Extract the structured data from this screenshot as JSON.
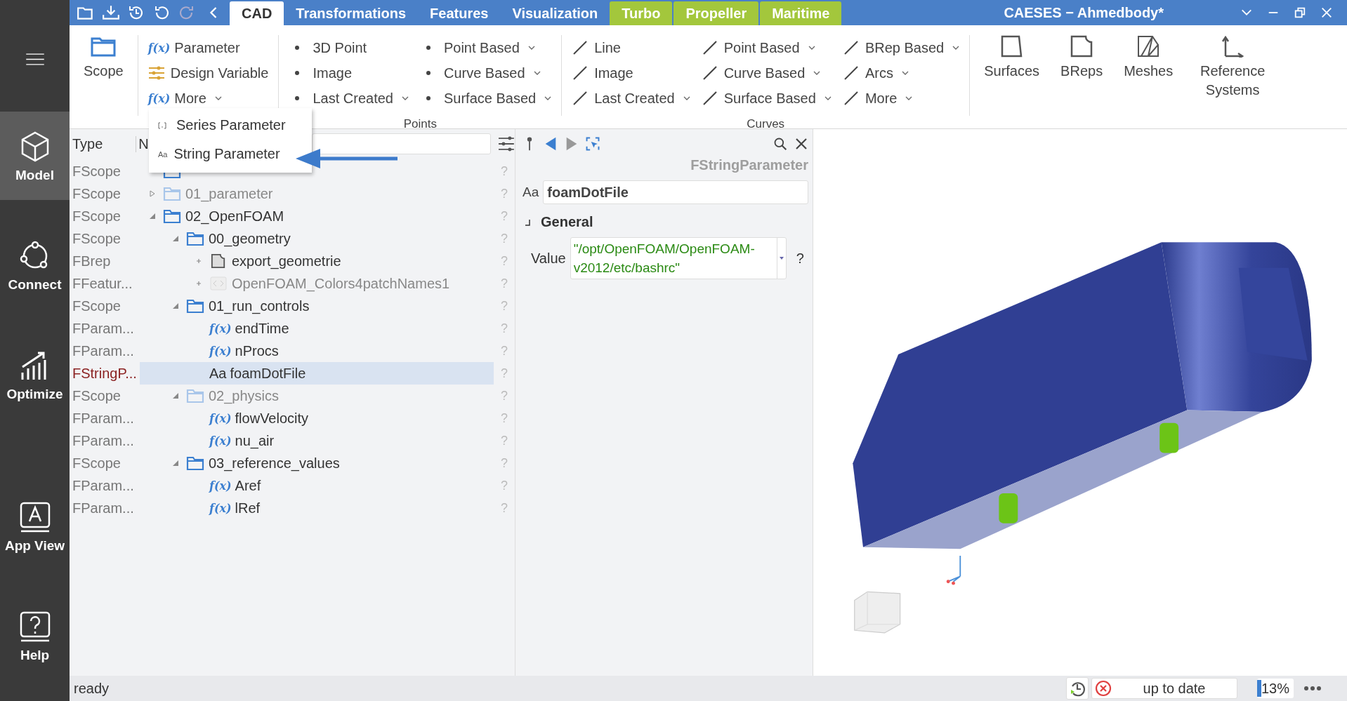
{
  "sidebar": {
    "items": [
      {
        "label": "Model",
        "kind": "cube",
        "selected": true
      },
      {
        "label": "Connect",
        "kind": "connect",
        "selected": false
      },
      {
        "label": "Optimize",
        "kind": "chart",
        "selected": false
      },
      {
        "label": "App View",
        "kind": "app",
        "selected": false
      },
      {
        "label": "Help",
        "kind": "help",
        "selected": false
      }
    ]
  },
  "tabs": [
    {
      "label": "CAD",
      "selected": true,
      "kind": "plain"
    },
    {
      "label": "Transformations",
      "selected": false,
      "kind": "plain"
    },
    {
      "label": "Features",
      "selected": false,
      "kind": "plain"
    },
    {
      "label": "Visualization",
      "selected": false,
      "kind": "plain"
    },
    {
      "label": "Turbo",
      "selected": false,
      "kind": "addon"
    },
    {
      "label": "Propeller",
      "selected": false,
      "kind": "addon"
    },
    {
      "label": "Maritime",
      "selected": false,
      "kind": "addon"
    }
  ],
  "window": {
    "title": "CAESES − Ahmedbody*"
  },
  "ribbon": {
    "groups": [
      {
        "kind": "big",
        "buttons": [
          {
            "label": "Scope",
            "kind": "folder"
          }
        ]
      },
      {
        "kind": "list",
        "columns": [
          [
            {
              "label": "Parameter",
              "kind": "fx",
              "icon_text": "f(x)",
              "dropdown": false
            },
            {
              "label": "Design Variable",
              "kind": "sliders",
              "dropdown": false
            },
            {
              "label": "More",
              "kind": "fx",
              "icon_text": "f(x)",
              "dropdown": true
            }
          ]
        ]
      },
      {
        "kind": "list",
        "title": "Points",
        "columns": [
          [
            {
              "label": "3D Point",
              "kind": "bullet",
              "dropdown": false
            },
            {
              "label": "Image",
              "kind": "bullet",
              "dropdown": false
            },
            {
              "label": "Last Created",
              "kind": "bullet",
              "dropdown": true
            }
          ],
          [
            {
              "label": "Point Based",
              "kind": "bullet",
              "dropdown": true
            },
            {
              "label": "Curve Based",
              "kind": "bullet",
              "dropdown": true
            },
            {
              "label": "Surface Based",
              "kind": "bullet",
              "dropdown": true
            }
          ]
        ]
      },
      {
        "kind": "list",
        "title": "Curves",
        "columns": [
          [
            {
              "label": "Line",
              "kind": "line",
              "dropdown": false
            },
            {
              "label": "Image",
              "kind": "line",
              "dropdown": false
            },
            {
              "label": "Last Created",
              "kind": "line",
              "dropdown": true
            }
          ],
          [
            {
              "label": "Point Based",
              "kind": "line",
              "dropdown": true
            },
            {
              "label": "Curve Based",
              "kind": "line",
              "dropdown": true
            },
            {
              "label": "Surface Based",
              "kind": "line",
              "dropdown": true
            }
          ],
          [
            {
              "label": "BRep Based",
              "kind": "line",
              "dropdown": true
            },
            {
              "label": "Arcs",
              "kind": "line",
              "dropdown": true
            },
            {
              "label": "More",
              "kind": "line",
              "dropdown": true
            }
          ]
        ]
      },
      {
        "kind": "big",
        "buttons": [
          {
            "label": "Surfaces",
            "kind": "surface"
          },
          {
            "label": "BReps",
            "kind": "brep"
          },
          {
            "label": "Meshes",
            "kind": "mesh"
          },
          {
            "label": "Reference Systems",
            "kind": "axes"
          }
        ]
      }
    ]
  },
  "dropdown_menu": {
    "items": [
      {
        "label": "Series Parameter",
        "kind": "series"
      },
      {
        "label": "String Parameter",
        "kind": "string",
        "icon_text": "Aa"
      }
    ]
  },
  "tree": {
    "columns": [
      "Type",
      "N"
    ],
    "items": [
      {
        "type": "FScope",
        "kind": "folder",
        "selected": false,
        "dimmed": false
      },
      {
        "type": "FScope",
        "name": "01_parameter",
        "kind": "folder",
        "expanded": false,
        "selected": false,
        "dimmed": true
      },
      {
        "type": "FScope",
        "name": "02_OpenFOAM",
        "kind": "folder",
        "expanded": true,
        "selected": false,
        "dimmed": false,
        "children": [
          {
            "type": "FScope",
            "name": "00_geometry",
            "kind": "folder",
            "expanded": true,
            "selected": false,
            "dimmed": false,
            "children": [
              {
                "type": "FBrep",
                "name": "export_geometrie",
                "kind": "brep",
                "expanded": false,
                "selected": false,
                "dimmed": false
              },
              {
                "type": "FFeatur...",
                "name": "OpenFOAM_Colors4patchNames1",
                "kind": "feature",
                "expanded": false,
                "selected": false,
                "dimmed": true
              }
            ]
          },
          {
            "type": "FScope",
            "name": "01_run_controls",
            "kind": "folder",
            "expanded": true,
            "selected": false,
            "dimmed": false,
            "children": [
              {
                "type": "FParam...",
                "name": "endTime",
                "kind": "parameter",
                "icon_text": "f(x)",
                "selected": false,
                "dimmed": false
              },
              {
                "type": "FParam...",
                "name": "nProcs",
                "kind": "parameter",
                "icon_text": "f(x)",
                "selected": false,
                "dimmed": false
              },
              {
                "type": "FStringP...",
                "name": "foamDotFile",
                "kind": "string",
                "icon_text": "Aa",
                "selected": true,
                "dimmed": false
              }
            ]
          },
          {
            "type": "FScope",
            "name": "02_physics",
            "kind": "folder",
            "expanded": true,
            "selected": false,
            "dimmed": true,
            "children": [
              {
                "type": "FParam...",
                "name": "flowVelocity",
                "kind": "parameter",
                "icon_text": "f(x)",
                "selected": false,
                "dimmed": false
              },
              {
                "type": "FParam...",
                "name": "nu_air",
                "kind": "parameter",
                "icon_text": "f(x)",
                "selected": false,
                "dimmed": false
              }
            ]
          },
          {
            "type": "FScope",
            "name": "03_reference_values",
            "kind": "folder",
            "expanded": true,
            "selected": false,
            "dimmed": false,
            "children": [
              {
                "type": "FParam...",
                "name": "Aref",
                "kind": "parameter",
                "icon_text": "f(x)",
                "selected": false,
                "dimmed": false
              },
              {
                "type": "FParam...",
                "name": "lRef",
                "kind": "parameter",
                "icon_text": "f(x)",
                "selected": false,
                "dimmed": false
              }
            ]
          }
        ]
      }
    ],
    "help_mark": "?"
  },
  "properties": {
    "type_title": "FStringParameter",
    "name_prefix": "Aa",
    "name": "foamDotFile",
    "section": {
      "title": "General",
      "expanded": true
    },
    "value_label": "Value",
    "value": "\"/opt/OpenFOAM/OpenFOAM-v2012/etc/bashrc\"",
    "help_mark": "?"
  },
  "status_bar": {
    "message": "ready",
    "state": "up to date",
    "progress": {
      "level": 0.13,
      "reading": "13%"
    }
  }
}
